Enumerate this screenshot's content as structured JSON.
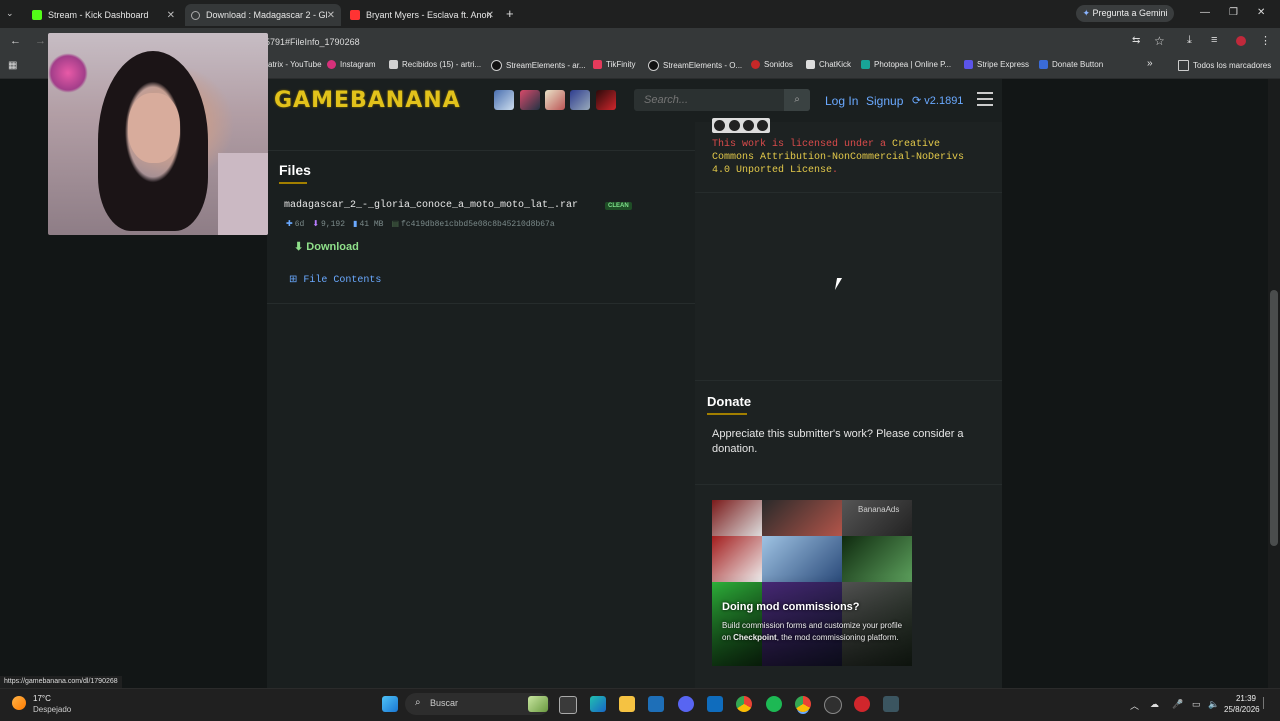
{
  "browser": {
    "tabs": [
      {
        "title": "Stream - Kick Dashboard",
        "color": "#53fc18"
      },
      {
        "title": "Download : Madagascar 2 - Gl",
        "color": "#aaaaaa"
      },
      {
        "title": "Bryant Myers - Esclava ft. Anon",
        "color": "#ff3333"
      }
    ],
    "new_tab": "+",
    "gemini": "Pregunta a Gemini",
    "address": "5791#FileInfo_1790268",
    "bookmarks": [
      "atrix - YouTube",
      "Instagram",
      "Recibidos (15) - artri...",
      "StreamElements - ar...",
      "TikFinity",
      "StreamElements - O...",
      "Sonidos",
      "ChatKick",
      "Photopea | Online P...",
      "Stripe Express",
      "Donate Button"
    ],
    "bookmarks_more": "»",
    "all_bookmarks": "Todos los marcadores",
    "status_url": "https://gamebanana.com/dl/1790268"
  },
  "site": {
    "logo": "GAMEBANANA",
    "search_placeholder": "Search...",
    "login": "Log In",
    "signup": "Signup",
    "version": "v2.1891"
  },
  "files": {
    "title": "Files",
    "filename": "madagascar_2_-_gloria_conoce_a_moto_moto_lat_.rar",
    "badge": "CLEAN",
    "age": "6d",
    "downloads": "9,192",
    "size": "41 MB",
    "hash": "fc419db8e1cbbd5e08c8b45210d8b67a",
    "download_label": "Download",
    "contents_label": "File Contents"
  },
  "license": {
    "prefix": "This work is licensed under a ",
    "link": "Creative Commons Attribution-NonCommercial-NoDerivs 4.0 Unported License",
    "suffix": "."
  },
  "donate": {
    "title": "Donate",
    "text": "Appreciate this submitter's work? Please consider a donation."
  },
  "ad": {
    "label": "BananaAds",
    "title": "Doing mod commissions?",
    "text_pre": "Build commission forms and customize your profile on ",
    "text_bold": "Checkpoint",
    "text_post": ", the mod commissioning platform."
  },
  "taskbar": {
    "weather_temp": "17°C",
    "weather_desc": "Despejado",
    "search": "Buscar",
    "time": "21:39",
    "date": "25/8/2026"
  }
}
